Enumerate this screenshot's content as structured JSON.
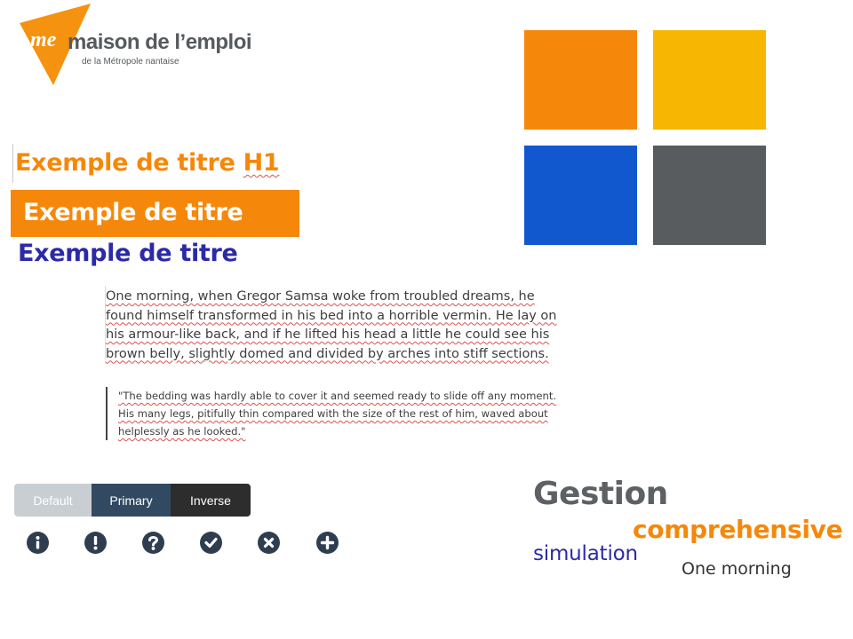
{
  "logo": {
    "mark": "me",
    "name": "maison de l’emploi",
    "subtitle": "de la Métropole nantaise"
  },
  "palette": [
    {
      "name": "orange",
      "color": "#f5880a"
    },
    {
      "name": "yellow",
      "color": "#f6b602"
    },
    {
      "name": "blue",
      "color": "#1158cf"
    },
    {
      "name": "gray",
      "color": "#585c5e"
    }
  ],
  "headings": {
    "h1_text": "Exemple de titre ",
    "h1_suffix": "H1",
    "h2_text": "Exemple de titre",
    "h3_text": "Exemple de titre"
  },
  "paragraph": "One morning, when Gregor Samsa woke from troubled dreams, he found himself transformed in his bed into a horrible vermin. He lay on his armour-like back, and if he lifted his head a little he could see his brown belly, slightly domed and divided by arches into stiff sections.",
  "blockquote": "\"The bedding was hardly able to cover it and seemed ready to slide off any moment. His many legs, pitifully thin compared with the size of the rest of him, waved about helplessly as he looked.\"",
  "buttons": {
    "default_label": "Default",
    "primary_label": "Primary",
    "inverse_label": "Inverse"
  },
  "icons": [
    "info-icon",
    "exclamation-icon",
    "question-icon",
    "check-icon",
    "close-icon",
    "plus-icon"
  ],
  "word_cloud": {
    "word1": "Gestion",
    "word2": "comprehensive",
    "word3": "simulation",
    "word4": "One morning"
  }
}
